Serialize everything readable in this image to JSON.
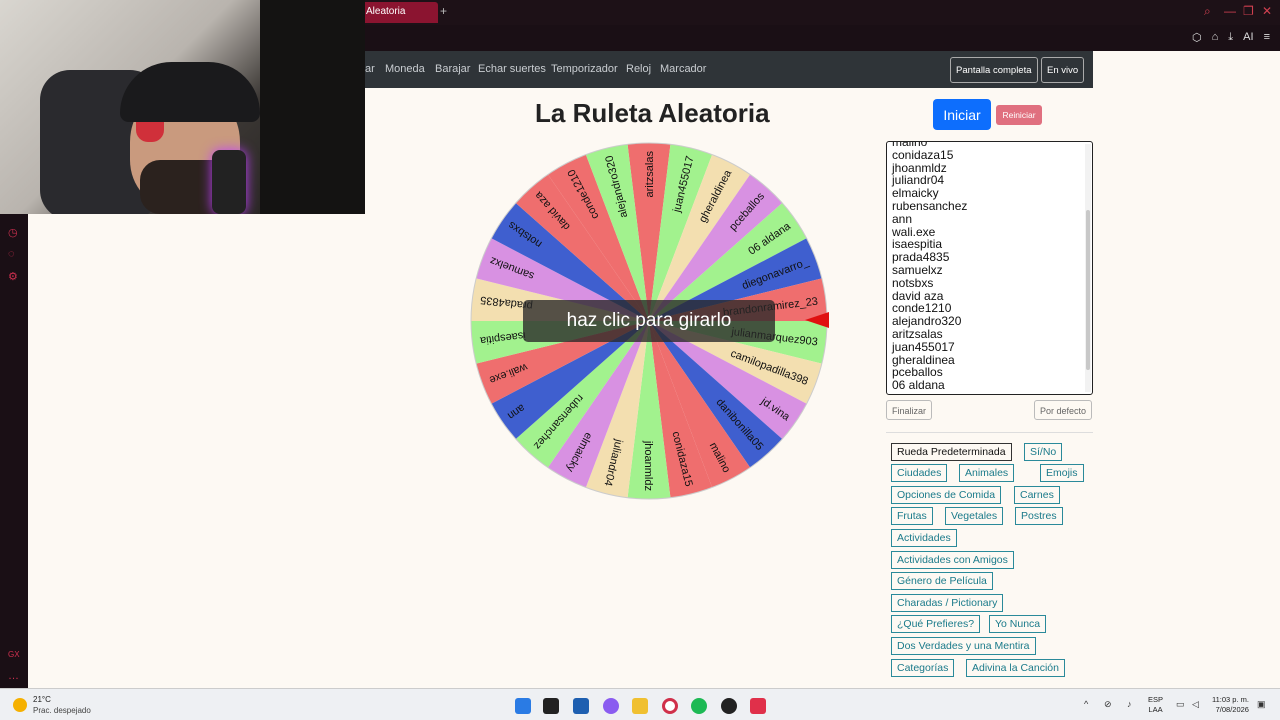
{
  "browser": {
    "tab_title": "Aleatoria",
    "new_tab": "+",
    "ai_label": "AI"
  },
  "nav": {
    "links": [
      "ar",
      "Moneda",
      "Barajar",
      "Echar suertes",
      "Temporizador",
      "Reloj",
      "Marcador"
    ],
    "fullscreen": "Pantalla completa",
    "live": "En vivo"
  },
  "page": {
    "title": "La Ruleta Aleatoria",
    "start_button": "Iniciar",
    "reset_button": "Reiniciar",
    "spin_hint": "haz clic para girarlo",
    "finish_button": "Finalizar",
    "default_button": "Por defecto"
  },
  "names_list": [
    "malino",
    "conidaza15",
    "jhoanmldz",
    "juliandr04",
    "elmaicky",
    "rubensanchez",
    "ann",
    "wali.exe",
    "isaespitia",
    "prada4835",
    "samuelxz",
    "notsbxs",
    "david aza",
    "conde1210",
    "alejandro320",
    "aritzsalas",
    "juan455017",
    "gheraldinea",
    "pceballos",
    "06 aldana"
  ],
  "wheel": {
    "entries": [
      "aritzsalas",
      "juan455017",
      "gheraldinea",
      "pceballos",
      "06 aldana",
      "diegonavarro_",
      "brandonramirez_23",
      "julianmarquez903",
      "camilopadilla398",
      "jd.vina",
      "danibonilla05",
      "malino",
      "conidaza15",
      "jhoanmldz",
      "juliandr04",
      "elmaicky",
      "rubensanchez",
      "ann",
      "wali.exe",
      "isaespitia",
      "prada4835",
      "samuelxz",
      "notsbxs",
      "david aza",
      "conde1210",
      "alejandro320"
    ],
    "colors": [
      "#ef6e6e",
      "#a2f28e",
      "#f3dfb0",
      "#d891e2",
      "#a2f28e",
      "#3f5fcf",
      "#ef6e6e",
      "#a2f28e",
      "#f3dfb0",
      "#d891e2",
      "#3f5fcf",
      "#ef6e6e"
    ],
    "pointer_color": "#e01010"
  },
  "presets": [
    {
      "label": "Rueda Predeterminada"
    },
    {
      "label": "Sí/No"
    },
    {
      "label": "Ciudades"
    },
    {
      "label": "Animales"
    },
    {
      "label": "Emojis"
    },
    {
      "label": "Opciones de Comida"
    },
    {
      "label": "Carnes"
    },
    {
      "label": "Frutas"
    },
    {
      "label": "Vegetales"
    },
    {
      "label": "Postres"
    },
    {
      "label": "Actividades"
    },
    {
      "label": "Actividades con Amigos"
    },
    {
      "label": "Género de Película"
    },
    {
      "label": "Charadas / Pictionary"
    },
    {
      "label": "¿Qué Prefieres?"
    },
    {
      "label": "Yo Nunca"
    },
    {
      "label": "Dos Verdades y una Mentira"
    },
    {
      "label": "Categorías"
    },
    {
      "label": "Adivina la Canción"
    }
  ],
  "taskbar": {
    "temperature": "21°C",
    "weather": "Prac. despejado",
    "lang_top": "ESP",
    "lang_bottom": "LAA",
    "time": "11:03 p. m.",
    "date": "7/08/2026"
  }
}
